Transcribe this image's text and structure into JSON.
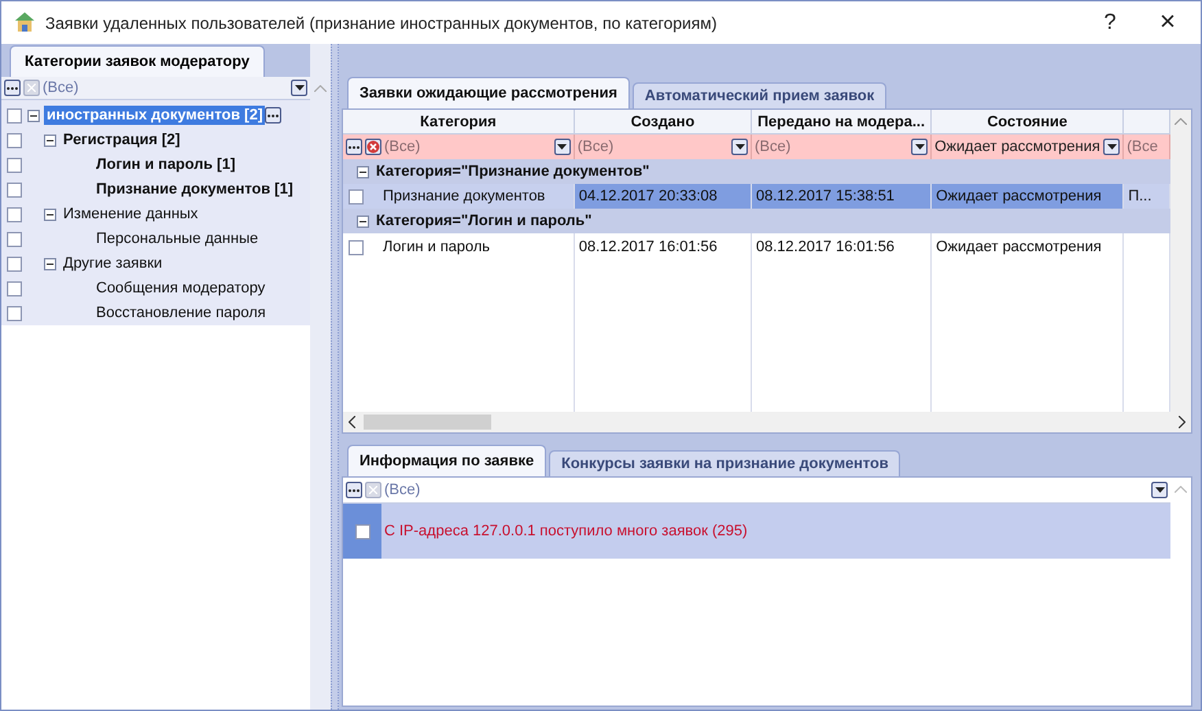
{
  "window": {
    "title": "Заявки удаленных пользователей (признание иностранных документов, по категориям)",
    "help": "?",
    "close": "×"
  },
  "left_panel": {
    "tab": {
      "label": "Категории заявок модератору",
      "selected": true
    },
    "filter": {
      "value": "(Все)"
    },
    "tree": [
      {
        "label": "иностранных документов [2]",
        "bold": true,
        "selected": true,
        "checked": false,
        "expanded": true,
        "children": [
          {
            "label": "Регистрация [2]",
            "bold": true,
            "selected": false,
            "checked": false,
            "expanded": true,
            "children": [
              {
                "label": "Логин и пароль [1]",
                "bold": true,
                "selected": false,
                "checked": false
              },
              {
                "label": "Признание документов [1]",
                "bold": true,
                "selected": false,
                "checked": false
              }
            ]
          },
          {
            "label": "Изменение данных",
            "bold": false,
            "selected": false,
            "checked": false,
            "expanded": true,
            "children": [
              {
                "label": "Персональные данные",
                "bold": false,
                "selected": false,
                "checked": false
              }
            ]
          },
          {
            "label": "Другие заявки",
            "bold": false,
            "selected": false,
            "checked": false,
            "expanded": true,
            "children": [
              {
                "label": "Сообщения модератору",
                "bold": false,
                "selected": false,
                "checked": false
              },
              {
                "label": "Восстановление пароля",
                "bold": false,
                "selected": false,
                "checked": false
              }
            ]
          }
        ]
      }
    ]
  },
  "requests": {
    "tabs": [
      {
        "label": "Заявки ожидающие рассмотрения",
        "selected": true
      },
      {
        "label": "Автоматический прием заявок",
        "selected": false
      }
    ],
    "table": {
      "columns": [
        "Категория",
        "Создано",
        "Передано на модера...",
        "Состояние"
      ],
      "filters": [
        "(Все)",
        "(Все)",
        "(Все)",
        "Ожидает рассмотрения",
        "(Все"
      ],
      "groups": [
        {
          "label": "Категория=\"Признание документов\"",
          "expanded": true,
          "rows": [
            {
              "cells": [
                "Признание документов",
                "04.12.2017 20:33:08",
                "08.12.2017 15:38:51",
                "Ожидает рассмотрения",
                "П..."
              ],
              "selected": true,
              "checked": false
            }
          ]
        },
        {
          "label": "Категория=\"Логин и пароль\"",
          "expanded": true,
          "rows": [
            {
              "cells": [
                "Логин и пароль",
                "08.12.2017 16:01:56",
                "08.12.2017 16:01:56",
                "Ожидает рассмотрения"
              ],
              "selected": false,
              "checked": false
            }
          ]
        }
      ]
    }
  },
  "details": {
    "tabs": [
      {
        "label": "Информация по заявке",
        "selected": true
      },
      {
        "label": "Конкурсы заявки на признание документов",
        "selected": false
      }
    ],
    "filter": {
      "value": "(Все)"
    },
    "messages": [
      {
        "text": "С IP-адреса 127.0.0.1 поступило много заявок (295)",
        "checked": false
      }
    ]
  }
}
